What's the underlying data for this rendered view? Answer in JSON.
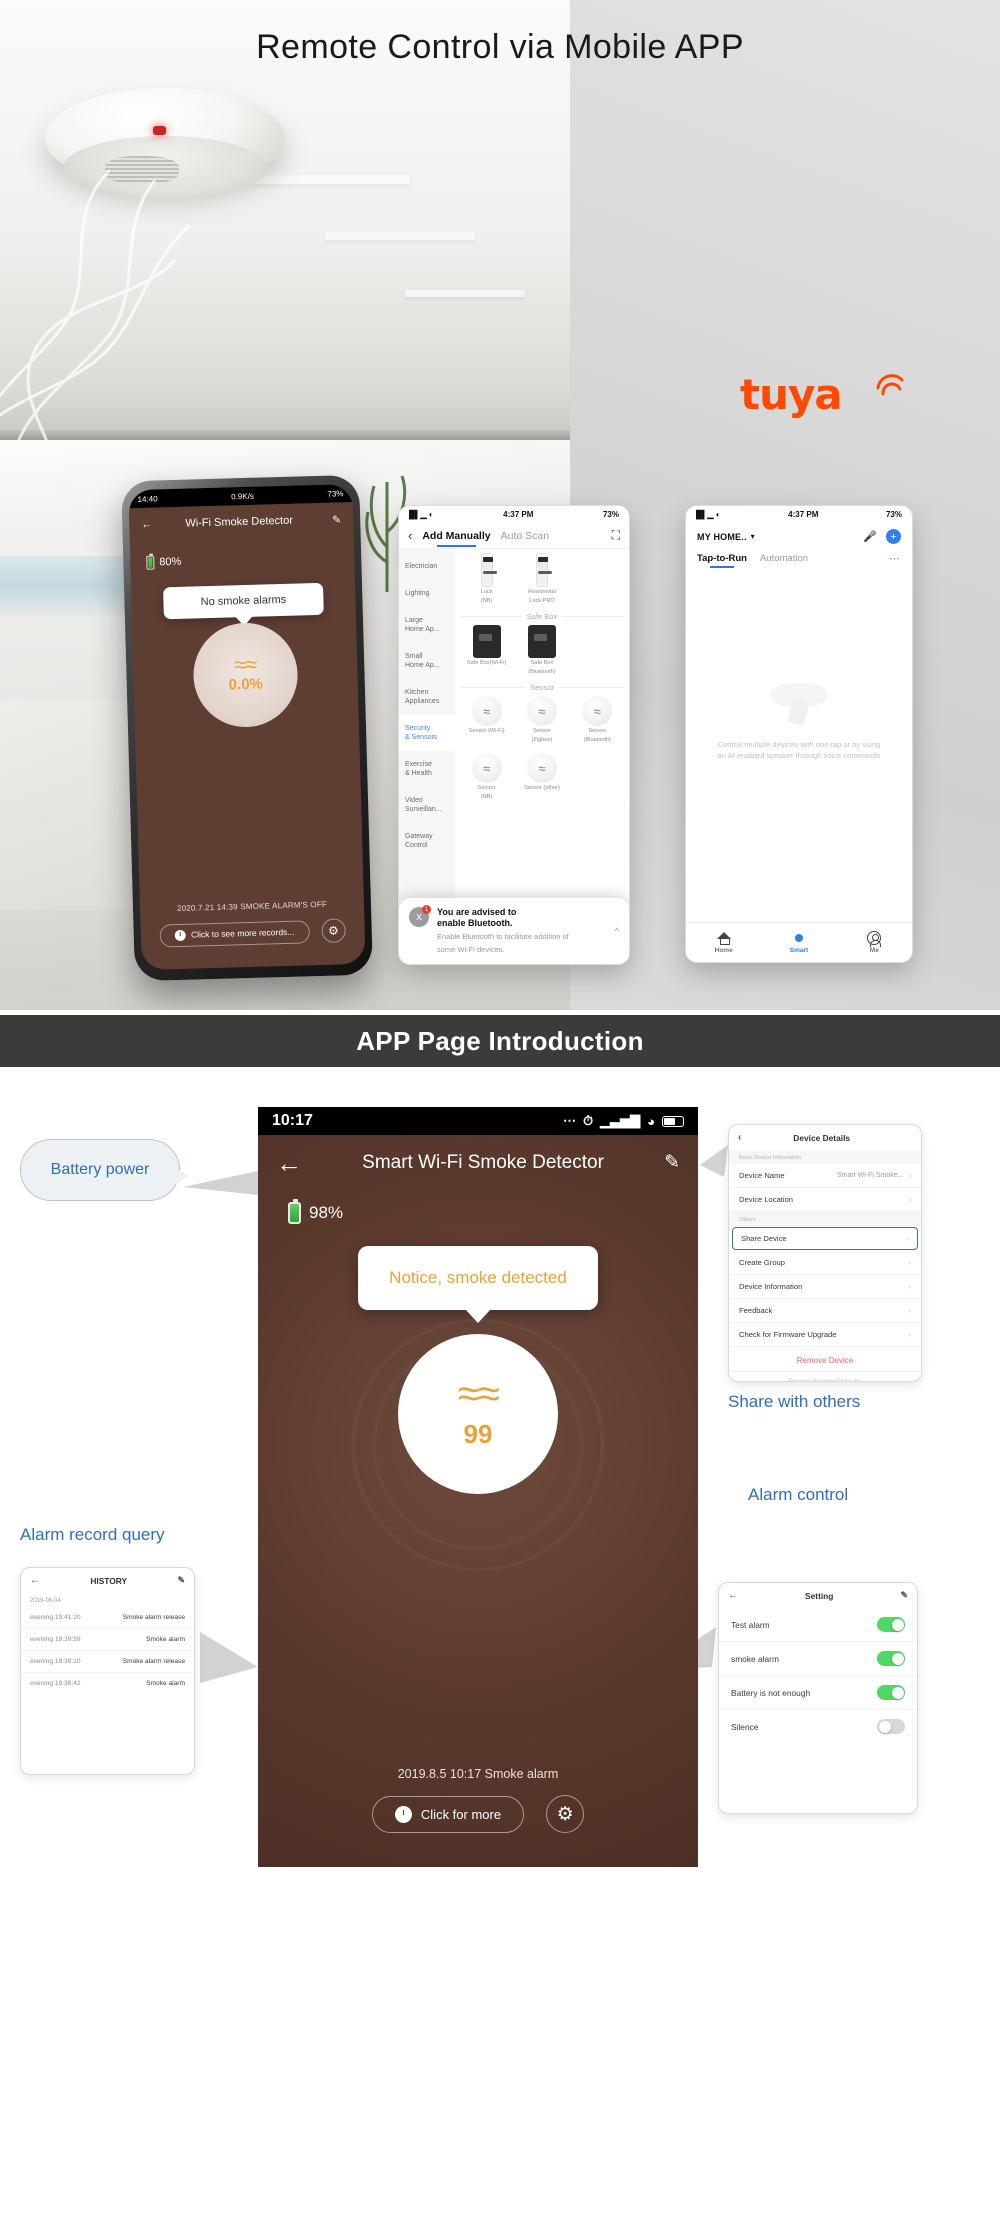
{
  "hero": {
    "title": "Remote Control via Mobile APP",
    "brand": "tuya"
  },
  "phone_left": {
    "status": {
      "time": "14:40",
      "network": "0.9K/s",
      "right": "73%"
    },
    "nav": {
      "back_icon": "arrow-left-icon",
      "title": "Wi-Fi Smoke Detector",
      "edit_icon": "pencil-icon"
    },
    "battery": "80%",
    "alert": "No smoke alarms",
    "disc_value": "0.0%",
    "record": "2020.7.21 14:39    SMOKE ALARM'S OFF",
    "more_button": "Click to see more records...",
    "settings_icon": "gear-icon"
  },
  "phone_mid": {
    "status": {
      "time": "4:37 PM",
      "battery": "73%"
    },
    "nav": {
      "back_icon": "chevron-left-icon",
      "tab_active": "Add Manually",
      "tab_other": "Auto Scan",
      "scan_icon": "qr-scan-icon"
    },
    "sidebar": [
      "Electrician",
      "Lighting",
      "Large\nHome Ap...",
      "Small\nHome Ap...",
      "Kitchen\nAppliances",
      "Security\n& Sensors",
      "Exercise\n& Health",
      "Video\nSurveillan...",
      "Gateway\nControl"
    ],
    "sidebar_active_index": 5,
    "sections": [
      {
        "title": "",
        "items": [
          {
            "label": "Lock",
            "sub": "(NB)",
            "icon": "lock-device-icon"
          },
          {
            "label": "Residential",
            "sub": "Lock PRO",
            "icon": "lock-device-icon"
          }
        ]
      },
      {
        "title": "Safe Box",
        "items": [
          {
            "label": "Safe Box(Wi-Fi)",
            "sub": "",
            "icon": "safe-box-icon"
          },
          {
            "label": "Safe Box",
            "sub": "(Bluetooth)",
            "icon": "safe-box-icon"
          }
        ]
      },
      {
        "title": "Sensor",
        "items": [
          {
            "label": "Sensor (Wi-Fi)",
            "sub": "",
            "icon": "sensor-icon"
          },
          {
            "label": "Sensor",
            "sub": "(Zigbee)",
            "icon": "sensor-icon"
          },
          {
            "label": "Sensor",
            "sub": "(Bluetooth)",
            "icon": "sensor-icon"
          }
        ]
      },
      {
        "title": "",
        "items": [
          {
            "label": "Sensor",
            "sub": "(NB)",
            "icon": "sensor-icon"
          },
          {
            "label": "Sensor (other)",
            "sub": "",
            "icon": "sensor-icon"
          }
        ]
      }
    ],
    "toast": {
      "icon": "bluetooth-icon",
      "badge": "1",
      "title_line1": "You are advised to",
      "title_line2": "enable Bluetooth.",
      "desc_line1": "Enable Bluetooth to facilitate addition of",
      "desc_line2": "some Wi-Fi devices.",
      "chevron": "chevron-up-icon"
    }
  },
  "phone_right": {
    "status": {
      "time": "4:37 PM",
      "battery": "73%"
    },
    "home_label": "MY HOME..",
    "home_chevron": "chevron-down-icon",
    "mic_icon": "microphone-icon",
    "add_icon": "plus-icon",
    "tabs": [
      "Tap-to-Run",
      "Automation"
    ],
    "active_tab": "Tap-to-Run",
    "more_icon": "ellipsis-icon",
    "empty_text_line1": "Control multiple devices with one tap or by using",
    "empty_text_line2": "an AI-enabled speaker through voice commands",
    "bottom_nav": [
      {
        "label": "Home",
        "icon": "home-icon",
        "active": false
      },
      {
        "label": "Smart",
        "icon": "smart-icon",
        "active": true
      },
      {
        "label": "Me",
        "icon": "account-icon",
        "active": false
      }
    ]
  },
  "banner": {
    "title": "APP Page Introduction"
  },
  "main_phone": {
    "status": {
      "time": "10:17",
      "icons": "••• alarm signal wifi battery"
    },
    "nav": {
      "back_icon": "arrow-left-icon",
      "title": "Smart Wi-Fi Smoke Detector",
      "edit_icon": "pencil-icon"
    },
    "battery": "98%",
    "alert": "Notice, smoke detected",
    "disc_value": "99",
    "record": "2019.8.5 10:17 Smoke alarm",
    "more_button": "Click for more",
    "settings_icon": "gear-icon"
  },
  "callouts": {
    "battery_power": "Battery power",
    "share_with_others": "Share with others",
    "alarm_record_query": "Alarm record query",
    "alarm_control": "Alarm control"
  },
  "device_details": {
    "title": "Device Details",
    "back_icon": "chevron-left-icon",
    "section_basic": "Basic Device Information",
    "section_others": "Others",
    "rows_basic": [
      {
        "label": "Device Name",
        "value": "Smart Wi-Fi Smoke..."
      },
      {
        "label": "Device Location",
        "value": ""
      }
    ],
    "rows_others": [
      {
        "label": "Share Device",
        "highlighted": true
      },
      {
        "label": "Create Group",
        "highlighted": false
      },
      {
        "label": "Device Information",
        "highlighted": false
      },
      {
        "label": "Feedback",
        "highlighted": false
      },
      {
        "label": "Check for Firmware Upgrade",
        "highlighted": false
      }
    ],
    "remove": "Remove Device",
    "restore": "Restore Factory Defaults"
  },
  "setting_panel": {
    "title": "Setting",
    "back_icon": "arrow-left-icon",
    "edit_icon": "pencil-icon",
    "rows": [
      {
        "label": "Test alarm",
        "on": true
      },
      {
        "label": "smoke alarm",
        "on": true
      },
      {
        "label": "Battery is not enough",
        "on": true
      },
      {
        "label": "Silence",
        "on": false
      }
    ]
  },
  "history_panel": {
    "title": "HISTORY",
    "back_icon": "arrow-left-icon",
    "edit_icon": "pencil-icon",
    "date": "2019-08-04",
    "rows": [
      {
        "time": "evening  19:41:20",
        "event": "Smoke alarm release"
      },
      {
        "time": "evening  19:39:59",
        "event": "Smoke alarm"
      },
      {
        "time": "evening  19:39:10",
        "event": "Smoke alarm release"
      },
      {
        "time": "evening  19:38:42",
        "event": "Smoke alarm"
      }
    ]
  },
  "colors": {
    "accent_orange": "#e9a23b",
    "brand_orange": "#ff4800",
    "callout_blue": "#2f6fb5",
    "banner_dark": "#3b3b3b",
    "device_brown": "#5a392d",
    "toggle_green": "#4cd964"
  }
}
